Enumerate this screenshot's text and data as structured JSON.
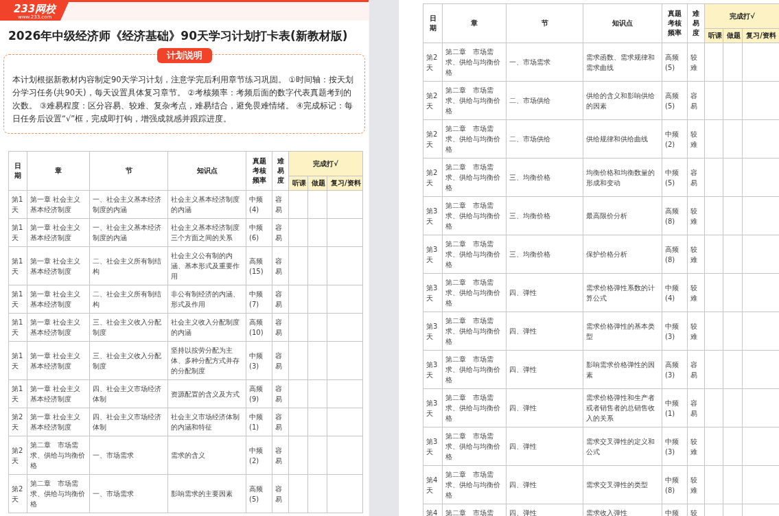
{
  "left_page": {
    "logo": "233网校",
    "logo_url": "www.233.com",
    "title": "2026年中级经济师《经济基础》90天学习计划打卡表(新教材版)",
    "plan_badge": "计划说明",
    "plan_text": "本计划根据新教材内容制定90天学习计划，注意学完后利用章节练习巩固。 ①时间轴：按天划分学习任务(共90天)，每天设置具体复习章节。 ②考核频率：考频后面的数字代表真题考到的次数。 ③难易程度：区分容易、较难、复杂考点，难易结合，避免畏难情绪。 ④完成标记：每日任务后设置“√”框，完成即打钩，增强成就感并跟踪进度。",
    "table": {
      "columns": [
        "日期",
        "章",
        "节",
        "知识点",
        "真题考核频率",
        "难易度"
      ],
      "check_group": "完成打√",
      "check_columns": [
        "听课",
        "做题",
        "复习/资料"
      ],
      "rows": [
        {
          "date": "第1天",
          "chapter": "第一章 社会主义基本经济制度",
          "section": "一、社会主义基本经济制度的内涵",
          "point": "社会主义基本经济制度的内涵",
          "frequency": "中频(4)",
          "difficulty": "容易"
        },
        {
          "date": "第1天",
          "chapter": "第一章 社会主义基本经济制度",
          "section": "一、社会主义基本经济制度的内涵",
          "point": "社会主义基本经济制度三个方面之间的关系",
          "frequency": "中频(6)",
          "difficulty": "容易"
        },
        {
          "date": "第1天",
          "chapter": "第一章 社会主义基本经济制度",
          "section": "二、社会主义所有制结构",
          "point": "社会主义公有制的内涵、基本形式及重要作用",
          "frequency": "高频(15)",
          "difficulty": "容易"
        },
        {
          "date": "第1天",
          "chapter": "第一章 社会主义基本经济制度",
          "section": "二、社会主义所有制结构",
          "point": "非公有制经济的内涵、形式及作用",
          "frequency": "中频(7)",
          "difficulty": "容易"
        },
        {
          "date": "第1天",
          "chapter": "第一章 社会主义基本经济制度",
          "section": "三、社会主义收入分配制度",
          "point": "社会主义收入分配制度的内涵",
          "frequency": "高频(10)",
          "difficulty": "容易"
        },
        {
          "date": "第1天",
          "chapter": "第一章 社会主义基本经济制度",
          "section": "三、社会主义收入分配制度",
          "point": "坚持以按劳分配为主体、多种分配方式并存的分配制度",
          "frequency": "中频(3)",
          "difficulty": "容易"
        },
        {
          "date": "第1天",
          "chapter": "第一章 社会主义基本经济制度",
          "section": "四、社会主义市场经济体制",
          "point": "资源配置的含义及方式",
          "frequency": "高频(9)",
          "difficulty": "容易"
        },
        {
          "date": "第2天",
          "chapter": "第一章 社会主义基本经济制度",
          "section": "四、社会主义市场经济体制",
          "point": "社会主义市场经济体制的内涵和特征",
          "frequency": "中频(1)",
          "difficulty": "容易"
        },
        {
          "date": "第2天",
          "chapter": "第二章　市场需求、供给与均衡价格",
          "section": "一、市场需求",
          "point": "需求的含义",
          "frequency": "中频(2)",
          "difficulty": "容易"
        },
        {
          "date": "第2天",
          "chapter": "第二章　市场需求、供给与均衡价格",
          "section": "一、市场需求",
          "point": "影响需求的主要因素",
          "frequency": "高频(5)",
          "difficulty": "容易"
        }
      ]
    }
  },
  "right_page": {
    "table": {
      "columns": [
        "日期",
        "章",
        "节",
        "知识点",
        "真题考核频率",
        "难易度"
      ],
      "check_group": "完成打√",
      "check_columns": [
        "听课",
        "做题",
        "复习/资料"
      ],
      "rows": [
        {
          "date": "第2天",
          "chapter": "第二章　市场需求、供给与均衡价格",
          "section": "一、市场需求",
          "point": "需求函数、需求规律和需求曲线",
          "frequency": "高频(5)",
          "difficulty": "较难"
        },
        {
          "date": "第2天",
          "chapter": "第二章　市场需求、供给与均衡价格",
          "section": "二、市场供给",
          "point": "供给的含义和影响供给的因素",
          "frequency": "高频(5)",
          "difficulty": "容易"
        },
        {
          "date": "第2天",
          "chapter": "第二章　市场需求、供给与均衡价格",
          "section": "二、市场供给",
          "point": "供给规律和供给曲线",
          "frequency": "中频(2)",
          "difficulty": "较难"
        },
        {
          "date": "第2天",
          "chapter": "第二章　市场需求、供给与均衡价格",
          "section": "三、均衡价格",
          "point": "均衡价格和均衡数量的形成和变动",
          "frequency": "中频(5)",
          "difficulty": "容易"
        },
        {
          "date": "第3天",
          "chapter": "第二章　市场需求、供给与均衡价格",
          "section": "三、均衡价格",
          "point": "最高限价分析",
          "frequency": "高频(8)",
          "difficulty": "较难"
        },
        {
          "date": "第3天",
          "chapter": "第二章　市场需求、供给与均衡价格",
          "section": "三、均衡价格",
          "point": "保护价格分析",
          "frequency": "高频(8)",
          "difficulty": "较难"
        },
        {
          "date": "第3天",
          "chapter": "第二章　市场需求、供给与均衡价格",
          "section": "四、弹性",
          "point": "需求价格弹性系数的计算公式",
          "frequency": "中频(4)",
          "difficulty": "较难"
        },
        {
          "date": "第3天",
          "chapter": "第二章　市场需求、供给与均衡价格",
          "section": "四、弹性",
          "point": "需求价格弹性的基本类型",
          "frequency": "中频(3)",
          "difficulty": "较难"
        },
        {
          "date": "第3天",
          "chapter": "第二章　市场需求、供给与均衡价格",
          "section": "四、弹性",
          "point": "影响需求价格弹性的因素",
          "frequency": "高频(3)",
          "difficulty": "容易"
        },
        {
          "date": "第3天",
          "chapter": "第二章　市场需求、供给与均衡价格",
          "section": "四、弹性",
          "point": "需求价格弹性和生产者或者销售者的总销售收入的关系",
          "frequency": "中频(1)",
          "difficulty": "容易"
        },
        {
          "date": "第3天",
          "chapter": "第二章　市场需求、供给与均衡价格",
          "section": "四、弹性",
          "point": "需求交叉弹性的定义和公式",
          "frequency": "中频(3)",
          "difficulty": "较难"
        },
        {
          "date": "第4天",
          "chapter": "第二章　市场需求、供给与均衡价格",
          "section": "四、弹性",
          "point": "需求交叉弹性的类型",
          "frequency": "中频(8)",
          "difficulty": "较难"
        },
        {
          "date": "第4",
          "chapter": "第二章　市场需",
          "section": "四、弹性",
          "point": "需求收入弹性",
          "frequency": "中频",
          "difficulty": "较"
        }
      ]
    }
  }
}
